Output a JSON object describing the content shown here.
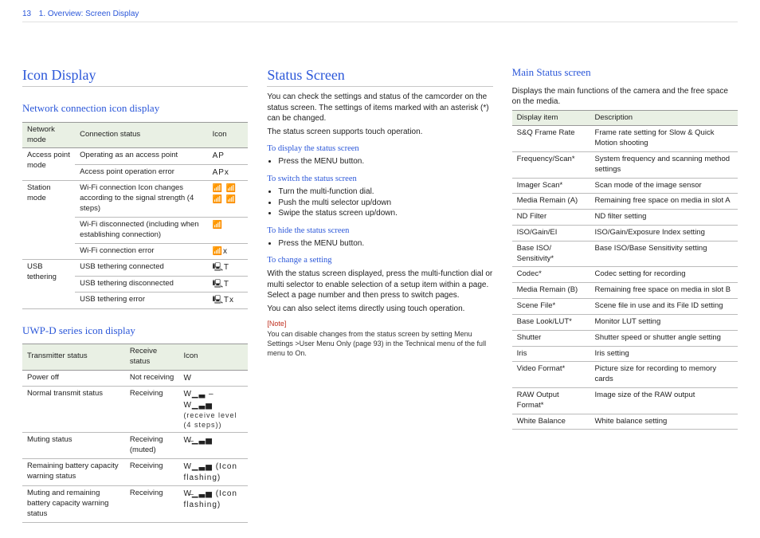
{
  "header": {
    "page_number": "13",
    "breadcrumb": "1. Overview: Screen Display"
  },
  "col1": {
    "h1": "Icon Display",
    "sec1": {
      "title": "Network connection icon display",
      "head": [
        "Network mode",
        "Connection status",
        "Icon"
      ],
      "rows": [
        {
          "mode": "Access point mode",
          "status": "Operating as an access point",
          "icon": "AP",
          "rs": 2
        },
        {
          "mode": "",
          "status": "Access point operation error",
          "icon": "APx"
        },
        {
          "mode": "Station mode",
          "status": "Wi-Fi connection\nIcon changes according to the signal strength (4 steps)",
          "icon": "📶 📶 📶 📶",
          "rs": 3
        },
        {
          "mode": "",
          "status": "Wi-Fi disconnected (including when establishing connection)",
          "icon": "📶"
        },
        {
          "mode": "",
          "status": "Wi-Fi connection error",
          "icon": "📶x"
        },
        {
          "mode": "USB tethering",
          "status": "USB tethering connected",
          "icon": "🖳T",
          "rs": 3
        },
        {
          "mode": "",
          "status": "USB tethering disconnected",
          "icon": "🖳T"
        },
        {
          "mode": "",
          "status": "USB tethering error",
          "icon": "🖳Tx"
        }
      ]
    },
    "sec2": {
      "title": "UWP-D series icon display",
      "head": [
        "Transmitter status",
        "Receive status",
        "Icon"
      ],
      "rows": [
        {
          "tx": "Power off",
          "rx": "Not receiving",
          "icon": "W"
        },
        {
          "tx": "Normal transmit status",
          "rx": "Receiving",
          "icon": "W▁▃ – W▁▃▅",
          "note": "(receive level (4 steps))"
        },
        {
          "tx": "Muting status",
          "rx": "Receiving (muted)",
          "icon": "W̶▁▃▅"
        },
        {
          "tx": "Remaining battery capacity warning status",
          "rx": "Receiving",
          "icon": "W▁▃▅ (Icon flashing)"
        },
        {
          "tx": "Muting and remaining battery capacity warning status",
          "rx": "Receiving",
          "icon": "W̶▁▃▅ (Icon flashing)"
        }
      ]
    }
  },
  "col2": {
    "h1": "Status Screen",
    "intro1": "You can check the settings and status of the camcorder on the status screen. The settings of items marked with an asterisk (*) can be changed.",
    "intro2": "The status screen supports touch operation.",
    "s1": {
      "title": "To display the status screen",
      "items": [
        "Press the MENU button."
      ]
    },
    "s2": {
      "title": "To switch the status screen",
      "items": [
        "Turn the multi-function dial.",
        "Push the multi selector up/down",
        "Swipe the status screen up/down."
      ]
    },
    "s3": {
      "title": "To hide the status screen",
      "items": [
        "Press the MENU button."
      ]
    },
    "s4": {
      "title": "To change a setting",
      "body1": "With the status screen displayed, press the multi-function dial or multi selector to enable selection of a setup item within a page. Select a page number and then press to switch pages.",
      "body2": "You can also select items directly using touch operation."
    },
    "note_label": "[Note]",
    "note_text": "You can disable changes from the status screen by setting Menu Settings >User Menu Only (page 93) in the Technical menu of the full menu to On."
  },
  "col3": {
    "title": "Main Status screen",
    "intro": "Displays the main functions of the camera and the free space on the media.",
    "head": [
      "Display item",
      "Description"
    ],
    "rows": [
      [
        "S&Q Frame Rate",
        "Frame rate setting for Slow & Quick Motion shooting"
      ],
      [
        "Frequency/Scan*",
        "System frequency and scanning method settings"
      ],
      [
        "Imager Scan*",
        "Scan mode of the image sensor"
      ],
      [
        "Media Remain (A)",
        "Remaining free space on media in slot A"
      ],
      [
        "ND Filter",
        "ND filter setting"
      ],
      [
        "ISO/Gain/EI",
        "ISO/Gain/Exposure Index setting"
      ],
      [
        "Base ISO/ Sensitivity*",
        "Base ISO/Base Sensitivity setting"
      ],
      [
        "Codec*",
        "Codec setting for recording"
      ],
      [
        "Media Remain (B)",
        "Remaining free space on media in slot B"
      ],
      [
        "Scene File*",
        "Scene file in use and its File ID setting"
      ],
      [
        "Base Look/LUT*",
        "Monitor LUT setting"
      ],
      [
        "Shutter",
        "Shutter speed or shutter angle setting"
      ],
      [
        "Iris",
        "Iris setting"
      ],
      [
        "Video Format*",
        "Picture size for recording to memory cards"
      ],
      [
        "RAW Output Format*",
        "Image size of the RAW output"
      ],
      [
        "White Balance",
        "White balance setting"
      ]
    ]
  }
}
